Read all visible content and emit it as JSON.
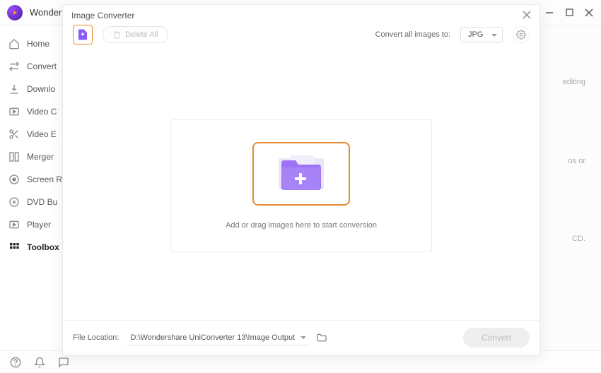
{
  "app": {
    "title": "Wonder"
  },
  "sidebar": {
    "items": [
      {
        "label": "Home"
      },
      {
        "label": "Convert"
      },
      {
        "label": "Downlo"
      },
      {
        "label": "Video C"
      },
      {
        "label": "Video E"
      },
      {
        "label": "Merger"
      },
      {
        "label": "Screen R"
      },
      {
        "label": "DVD Bu"
      },
      {
        "label": "Player"
      },
      {
        "label": "Toolbox"
      }
    ]
  },
  "modal": {
    "title": "Image Converter",
    "delete_all": "Delete All",
    "convert_all_label": "Convert all images to:",
    "format": "JPG",
    "drop_text": "Add or drag images here to start conversion",
    "file_location_label": "File Location:",
    "file_path": "D:\\Wondershare UniConverter 13\\Image Output",
    "convert_button": "Convert"
  },
  "background_hints": {
    "a": "editing",
    "b": "os or",
    "c": "CD."
  }
}
